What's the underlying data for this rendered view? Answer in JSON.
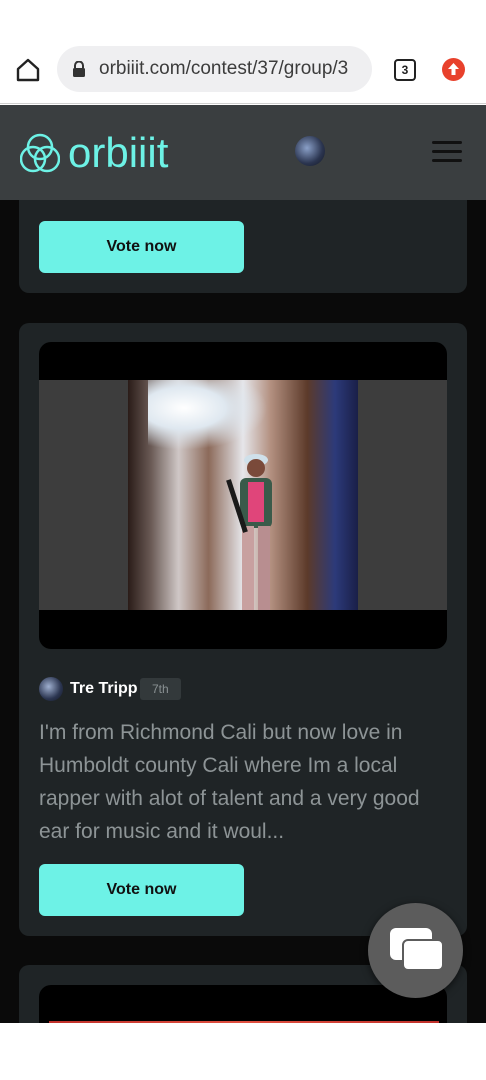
{
  "browser": {
    "url": "orbiiit.com/contest/37/group/3",
    "tab_count": "3",
    "icons": {
      "home": "home-icon",
      "lock": "lock-icon",
      "extension": "upload-extension-icon"
    }
  },
  "header": {
    "logo_text": "orbiiit",
    "accent_color": "#6df2e6",
    "menu_icon": "hamburger-menu-icon"
  },
  "cards": {
    "previous": {
      "vote_label": "Vote now"
    },
    "main": {
      "author": "Tre Tripp",
      "rank": "7th",
      "description": "I'm from Richmond Cali but now love in Humboldt county Cali where Im a local rapper with alot of talent and a very good ear for music and it woul...",
      "vote_label": "Vote now"
    }
  },
  "chat": {
    "icon": "chat-bubbles-icon"
  }
}
